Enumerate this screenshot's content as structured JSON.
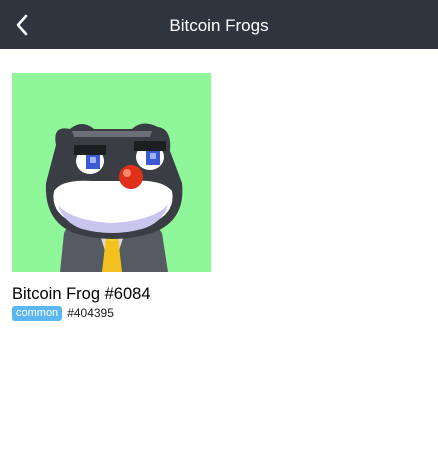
{
  "header": {
    "title": "Bitcoin Frogs",
    "back_icon": "chevron-left-icon"
  },
  "item": {
    "name": "Bitcoin Frog #6084",
    "rarity": "common",
    "inscription": "#404395",
    "colors": {
      "art_background": "#8ff79a",
      "rarity_badge": "#5cb6f0",
      "header": "#2e353f"
    }
  }
}
